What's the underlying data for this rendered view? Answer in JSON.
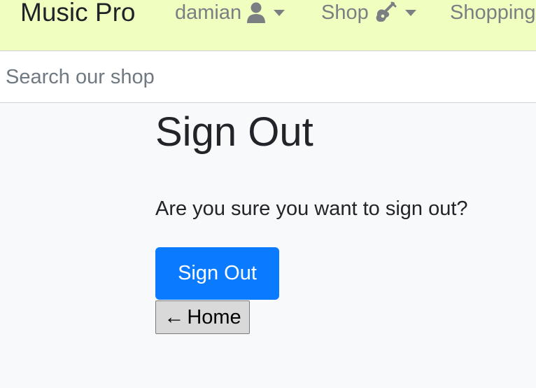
{
  "navbar": {
    "brand": "Music Pro",
    "user_menu": {
      "label": "damian",
      "icon": "user-icon"
    },
    "shop_menu": {
      "label": "Shop",
      "icon": "guitar-icon"
    },
    "cart_link": {
      "label": "Shopping"
    }
  },
  "search": {
    "placeholder": "Search our shop"
  },
  "main": {
    "title": "Sign Out",
    "prompt": "Are you sure you want to sign out?",
    "signout_button": "Sign Out",
    "home_button": {
      "arrow": "←",
      "label": "Home"
    }
  },
  "colors": {
    "navbar_bg": "#f0ffc0",
    "primary": "#0a7bff",
    "page_bg": "#f8f9fa"
  }
}
